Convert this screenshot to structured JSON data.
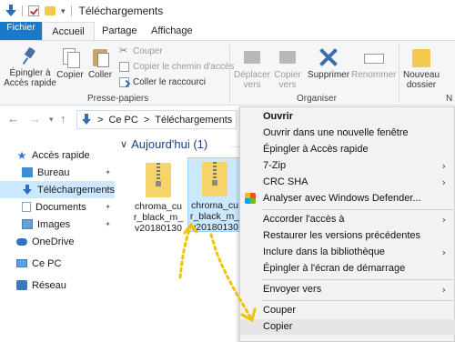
{
  "window": {
    "title": "Téléchargements"
  },
  "tabs": [
    "Fichier",
    "Accueil",
    "Partage",
    "Affichage"
  ],
  "ribbon": {
    "pin_label_1": "Épingler à",
    "pin_label_2": "Accès rapide",
    "copy_label": "Copier",
    "paste_label": "Coller",
    "cut_label": "Couper",
    "copy_path_label": "Copier le chemin d'accès",
    "paste_shortcut_label": "Coller le raccourci",
    "clipboard_group": "Presse-papiers",
    "move_label_1": "Déplacer",
    "move_label_2": "vers",
    "copyto_label_1": "Copier",
    "copyto_label_2": "vers",
    "delete_label": "Supprimer",
    "rename_label": "Renommer",
    "organize_group": "Organiser",
    "new_folder_label_1": "Nouveau",
    "new_folder_label_2": "dossier",
    "cut_off_group": "N"
  },
  "address": {
    "root": "Ce PC",
    "sep": ">",
    "folder": "Téléchargements"
  },
  "sidebar": {
    "items": [
      {
        "label": "Accès rapide"
      },
      {
        "label": "Bureau"
      },
      {
        "label": "Téléchargements"
      },
      {
        "label": "Documents"
      },
      {
        "label": "Images"
      },
      {
        "label": "OneDrive"
      },
      {
        "label": "Ce PC"
      },
      {
        "label": "Réseau"
      }
    ]
  },
  "content": {
    "group_title": "Aujourd'hui (1)",
    "files": [
      {
        "line1": "chroma_cu",
        "line2": "r_black_m_",
        "line3": "v20180130"
      },
      {
        "line1": "chroma_cu",
        "line2": "r_black_m_",
        "line3": "v20180130"
      }
    ]
  },
  "context_menu": {
    "items": [
      {
        "label": "Ouvrir"
      },
      {
        "label": "Ouvrir dans une nouvelle fenêtre"
      },
      {
        "label": "Épingler à Accès rapide"
      },
      {
        "label": "7-Zip"
      },
      {
        "label": "CRC SHA"
      },
      {
        "label": "Analyser avec Windows Defender..."
      },
      {
        "label": "Accorder l'accès à"
      },
      {
        "label": "Restaurer les versions précédentes"
      },
      {
        "label": "Inclure dans la bibliothèque"
      },
      {
        "label": "Épingler à l'écran de démarrage"
      },
      {
        "label": "Envoyer vers"
      },
      {
        "label": "Couper"
      },
      {
        "label": "Copier"
      }
    ]
  },
  "colors": {
    "accent": "#1979ca",
    "selection": "#cce8ff",
    "annotation": "#f2c200"
  }
}
